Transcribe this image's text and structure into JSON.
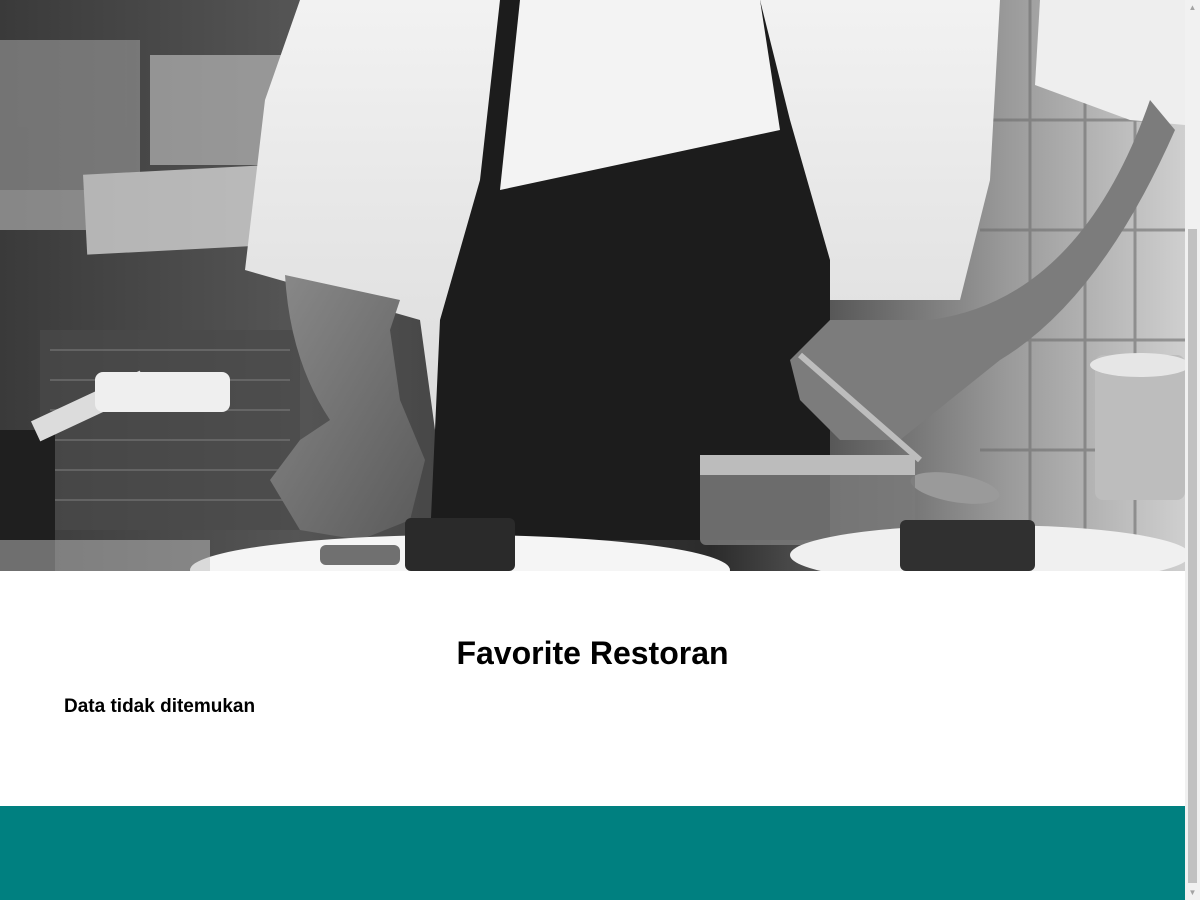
{
  "hero": {
    "image_description_name": "chef-plating-hero-image"
  },
  "main": {
    "title": "Favorite Restoran",
    "empty_message": "Data tidak ditemukan"
  },
  "colors": {
    "footer_background": "#008080",
    "page_background": "#ffffff",
    "text": "#000000"
  },
  "scrollbar": {
    "up_icon": "triangle-up-icon",
    "down_icon": "triangle-down-icon"
  }
}
